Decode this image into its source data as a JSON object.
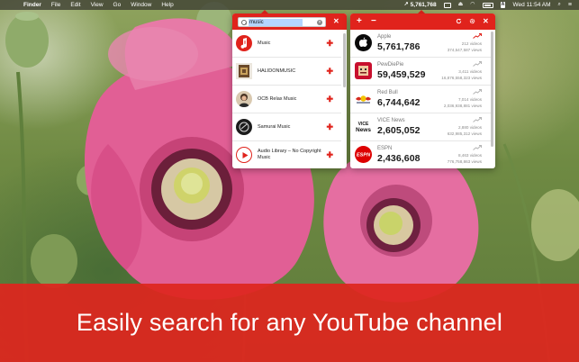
{
  "menubar": {
    "apple_glyph": "",
    "items": [
      "Finder",
      "File",
      "Edit",
      "View",
      "Go",
      "Window",
      "Help"
    ],
    "status_count": "5,761,768",
    "keyboard_indicator": "A",
    "clock": "Wed 11:54 AM"
  },
  "search": {
    "query": "music",
    "results": [
      {
        "name": "Music",
        "avatar_color": "#e0231c"
      },
      {
        "name": "HALIDONMUSIC",
        "avatar_color": "#6b4a2a"
      },
      {
        "name": "OCB Relax Music",
        "avatar_color": "#d9c9b0"
      },
      {
        "name": "Samurai Music",
        "avatar_color": "#1c1c1c"
      },
      {
        "name": "Audio Library – No Copyright Music",
        "avatar_color": "#e0231c"
      }
    ]
  },
  "stats": {
    "channels": [
      {
        "name": "Apple",
        "subscribers": "5,761,786",
        "videos": "212 videos",
        "views": "374,547,587 views",
        "icon": "apple-logo"
      },
      {
        "name": "PewDiePie",
        "subscribers": "59,459,529",
        "videos": "3,411 videos",
        "views": "16,876,558,323 views",
        "icon": "pewdiepie-logo"
      },
      {
        "name": "Red Bull",
        "subscribers": "6,744,642",
        "videos": "7,014 videos",
        "views": "2,036,938,881 views",
        "icon": "redbull-logo"
      },
      {
        "name": "VICE News",
        "subscribers": "2,605,052",
        "videos": "2,880 videos",
        "views": "632,985,312 views",
        "icon": "vice-news-logo"
      },
      {
        "name": "ESPN",
        "subscribers": "2,436,608",
        "videos": "8,463 videos",
        "views": "776,758,863 views",
        "icon": "espn-logo"
      }
    ],
    "vice_logo_top": "VICE",
    "vice_logo_bottom": "News",
    "espn_logo": "ESPN"
  },
  "banner": {
    "text": "Easily search for any YouTube channel"
  },
  "colors": {
    "accent": "#e0231c",
    "trend_up": "#e0231c",
    "trend_flat": "#b5b5b5"
  }
}
